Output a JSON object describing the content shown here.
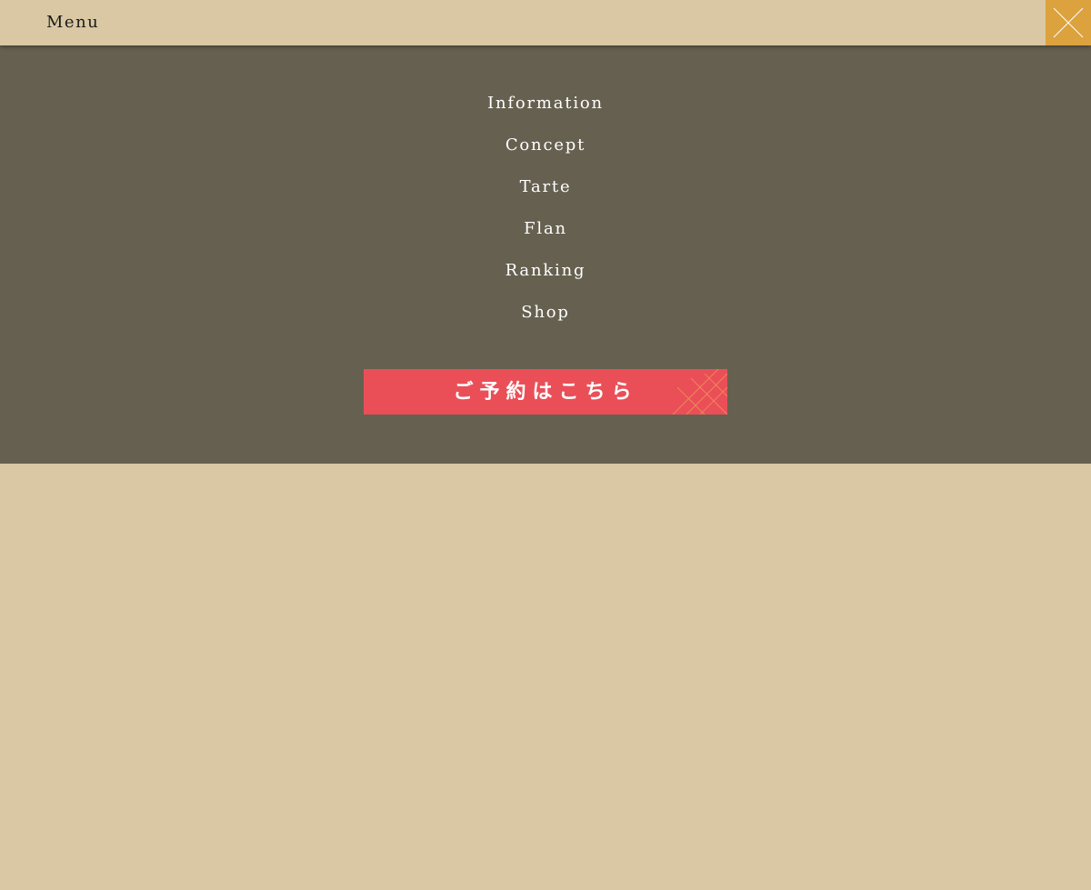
{
  "header": {
    "title": "Menu",
    "close_icon": "close-icon"
  },
  "nav": {
    "items": [
      {
        "label": "Information"
      },
      {
        "label": "Concept"
      },
      {
        "label": "Tarte"
      },
      {
        "label": "Flan"
      },
      {
        "label": "Ranking"
      },
      {
        "label": "Shop"
      }
    ]
  },
  "reservation": {
    "label": "ご予約はこちら"
  },
  "colors": {
    "page_background": "#d9c8a3",
    "menu_panel": "#666050",
    "close_button": "#dca23e",
    "reserve_button": "#ea4f58",
    "nav_text": "#ffffff"
  }
}
